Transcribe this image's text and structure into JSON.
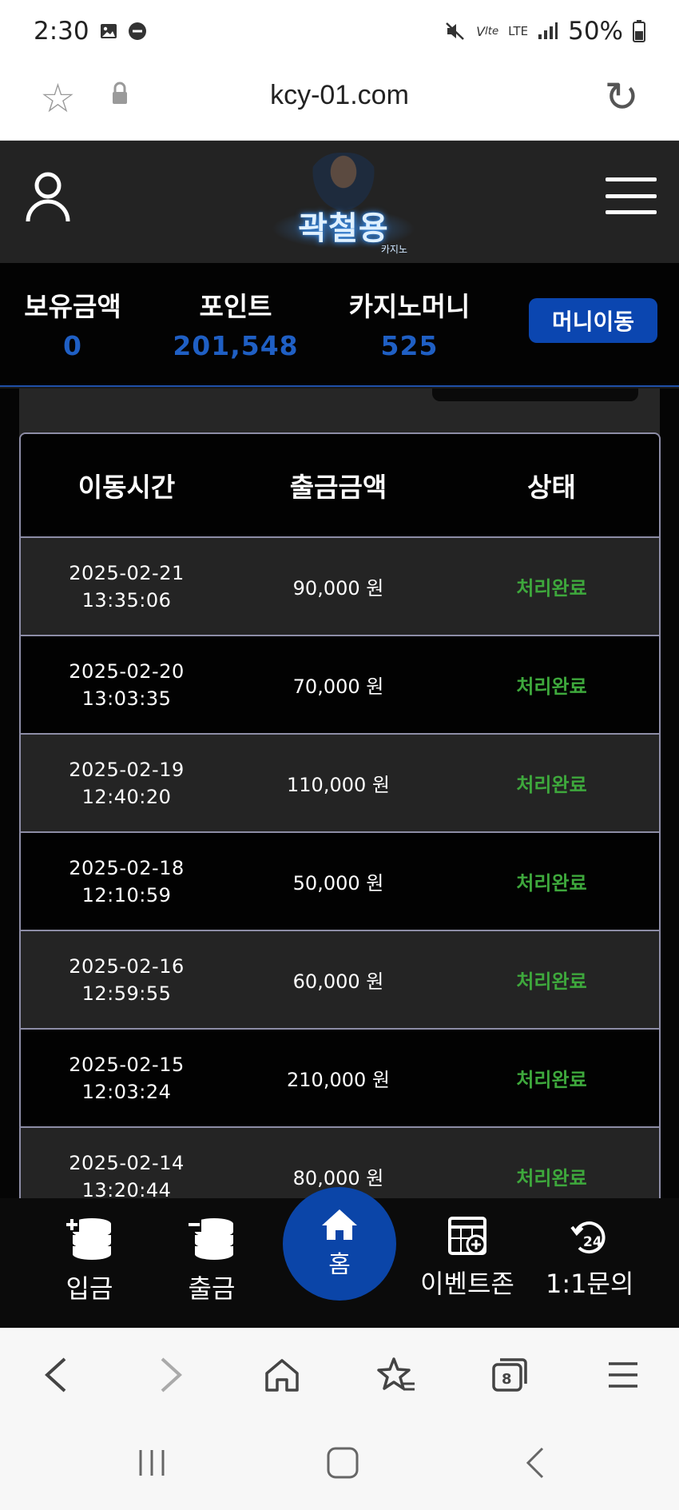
{
  "status_bar": {
    "time": "2:30",
    "network": "LTE",
    "battery": "50%"
  },
  "browser": {
    "url": "kcy-01.com",
    "tab_count": "8"
  },
  "header": {
    "logo_text": "곽철용",
    "logo_sub": "카지노"
  },
  "balance": {
    "hold_label": "보유금액",
    "hold_value": "0",
    "point_label": "포인트",
    "point_value": "201,548",
    "casino_label": "카지노머니",
    "casino_value": "525",
    "move_button": "머니이동"
  },
  "table": {
    "headers": {
      "time": "이동시간",
      "amount": "출금금액",
      "status": "상태"
    },
    "rows": [
      {
        "date": "2025-02-21",
        "time": "13:35:06",
        "amount": "90,000 원",
        "status": "처리완료"
      },
      {
        "date": "2025-02-20",
        "time": "13:03:35",
        "amount": "70,000 원",
        "status": "처리완료"
      },
      {
        "date": "2025-02-19",
        "time": "12:40:20",
        "amount": "110,000 원",
        "status": "처리완료"
      },
      {
        "date": "2025-02-18",
        "time": "12:10:59",
        "amount": "50,000 원",
        "status": "처리완료"
      },
      {
        "date": "2025-02-16",
        "time": "12:59:55",
        "amount": "60,000 원",
        "status": "처리완료"
      },
      {
        "date": "2025-02-15",
        "time": "12:03:24",
        "amount": "210,000 원",
        "status": "처리완료"
      },
      {
        "date": "2025-02-14",
        "time": "13:20:44",
        "amount": "80,000 원",
        "status": "처리완료"
      }
    ]
  },
  "bottom_nav": {
    "deposit": "입금",
    "withdraw": "출금",
    "home": "홈",
    "event": "이벤트존",
    "inquiry": "1:1문의"
  },
  "colors": {
    "accent_blue": "#0b45a8",
    "value_blue": "#1f5fc4",
    "status_green": "#3ea83c"
  }
}
